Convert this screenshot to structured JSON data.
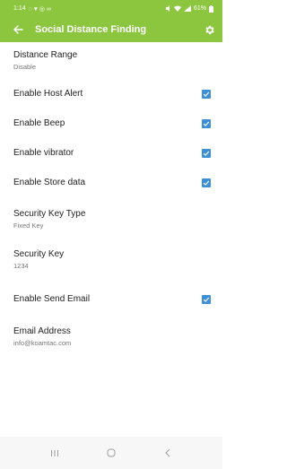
{
  "status_bar": {
    "time": "1:14",
    "notification_icons": "◌ ♥ ◎ ∞",
    "battery": "61%"
  },
  "app_bar": {
    "title": "Social Distance Finding"
  },
  "settings": [
    {
      "title": "Distance Range",
      "summary": "Disable",
      "checkbox": false
    },
    {
      "title": "Enable Host Alert",
      "summary": "",
      "checkbox": true,
      "checked": true
    },
    {
      "title": "Enable Beep",
      "summary": "",
      "checkbox": true,
      "checked": true
    },
    {
      "title": "Enable vibrator",
      "summary": "",
      "checkbox": true,
      "checked": true
    },
    {
      "title": "Enable Store data",
      "summary": "",
      "checkbox": true,
      "checked": true
    },
    {
      "title": "Security Key Type",
      "summary": "Fixed Key",
      "checkbox": false
    },
    {
      "title": "Security Key",
      "summary": "1234",
      "checkbox": false
    },
    {
      "title": "Enable Send Email",
      "summary": "",
      "checkbox": true,
      "checked": true
    },
    {
      "title": "Email Address",
      "summary": "info@koamtac.com",
      "checkbox": false
    }
  ],
  "colors": {
    "accent": "#8cc63f",
    "checkbox": "#3d8fd6"
  }
}
